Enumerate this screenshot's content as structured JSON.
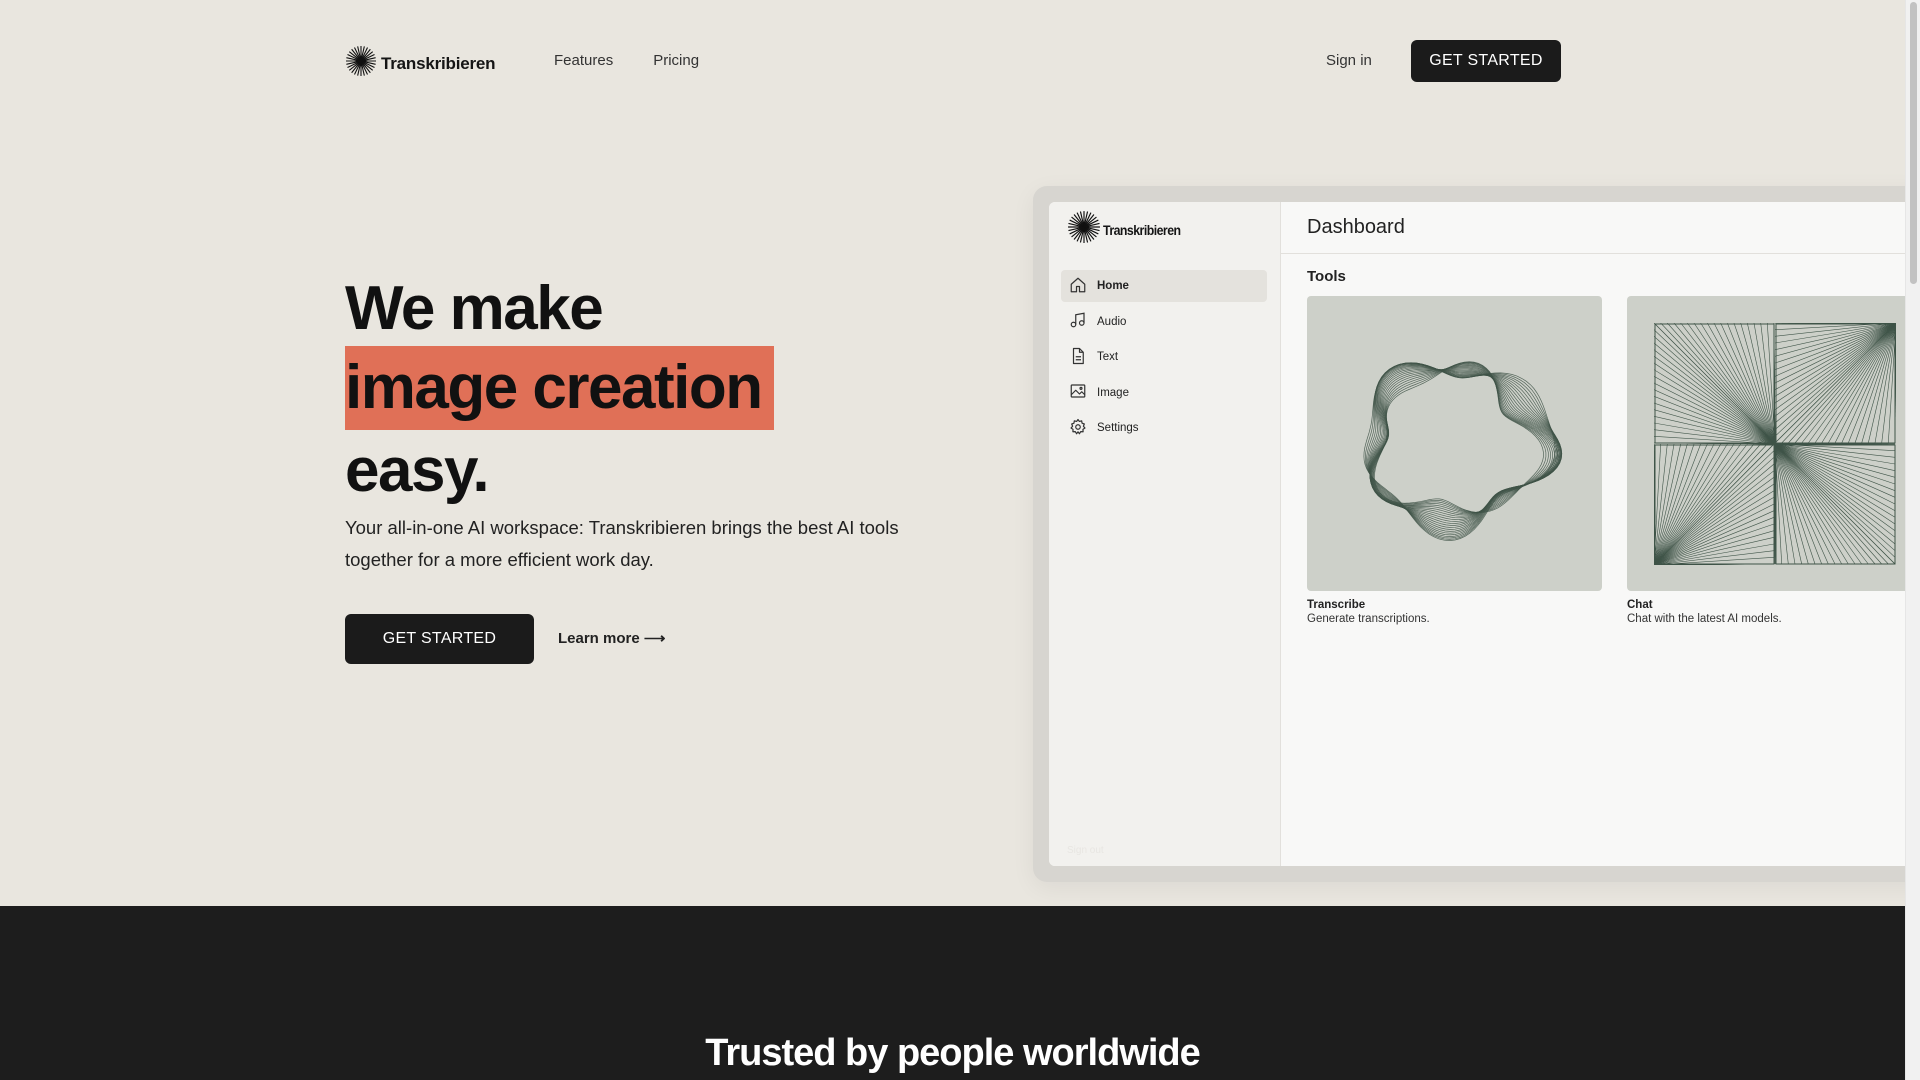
{
  "brand": {
    "name": "Transkribieren"
  },
  "nav": {
    "links": [
      "Features",
      "Pricing"
    ],
    "signin": "Sign in",
    "cta": "GET STARTED"
  },
  "hero": {
    "headline_line1": "We make",
    "headline_highlight": "image creation",
    "headline_line3": "easy.",
    "highlight_color": "#e07057",
    "subcopy": "Your all-in-one AI workspace: Transkribieren brings the best AI tools together for a more efficient work day.",
    "cta": "GET STARTED",
    "learn_more": "Learn more ⟶"
  },
  "mockup": {
    "brand": "Transkribieren",
    "sidebar": [
      {
        "label": "Home",
        "icon": "home-icon",
        "active": true
      },
      {
        "label": "Audio",
        "icon": "music-note-icon",
        "active": false
      },
      {
        "label": "Text",
        "icon": "document-icon",
        "active": false
      },
      {
        "label": "Image",
        "icon": "image-icon",
        "active": false
      },
      {
        "label": "Settings",
        "icon": "gear-icon",
        "active": false
      }
    ],
    "signout": "Sign out",
    "header": "Dashboard",
    "tools_title": "Tools",
    "tools": [
      {
        "name": "Transcribe",
        "desc": "Generate transcriptions."
      },
      {
        "name": "Chat",
        "desc": "Chat with the latest AI models."
      }
    ]
  },
  "trusted": {
    "title": "Trusted by people worldwide"
  },
  "colors": {
    "background": "#e9e6df",
    "dark": "#1d1d1d",
    "accent": "#e07057",
    "button": "#1b1b1b"
  }
}
